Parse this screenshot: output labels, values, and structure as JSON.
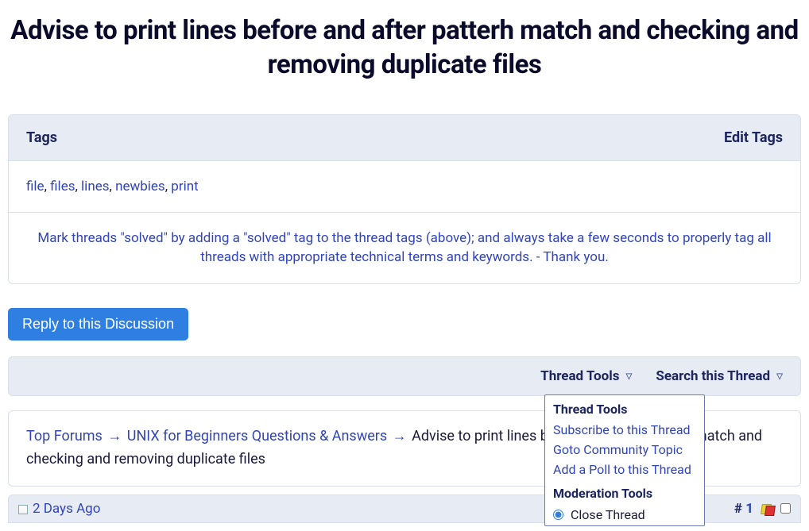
{
  "title": "Advise to print lines before and after patterh match and checking and removing duplicate files",
  "tagsPanel": {
    "heading": "Tags",
    "editLabel": "Edit Tags",
    "tags": [
      "file",
      "files",
      "lines",
      "newbies",
      "print"
    ],
    "advice": "Mark threads \"solved\" by adding a \"solved\" tag to the thread tags (above); and always take a few seconds to properly tag all threads with appropriate technical terms and keywords. - Thank you."
  },
  "replyButton": "Reply to this Discussion",
  "toolbar": {
    "threadTools": "Thread Tools",
    "searchThread": "Search this Thread"
  },
  "breadcrumb": {
    "top": "Top Forums",
    "forum": "UNIX for Beginners Questions & Answers",
    "current": "Advise to print lines before and after patterh match and checking and removing duplicate files"
  },
  "post": {
    "date": "2 Days Ago",
    "hash": "#",
    "number": "1"
  },
  "dropdown": {
    "title1": "Thread Tools",
    "items": [
      "Subscribe to this Thread",
      "Goto Community Topic",
      "Add a Poll to this Thread"
    ],
    "title2": "Moderation Tools",
    "radio1": "Close Thread"
  }
}
